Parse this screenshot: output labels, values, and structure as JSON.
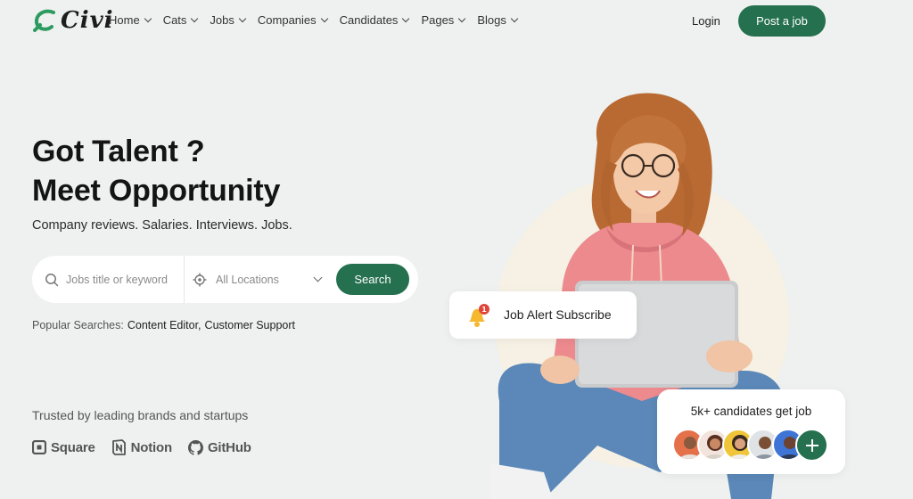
{
  "brand": {
    "name": "Civi"
  },
  "nav": {
    "items": [
      {
        "label": "Home"
      },
      {
        "label": "Cats"
      },
      {
        "label": "Jobs"
      },
      {
        "label": "Companies"
      },
      {
        "label": "Candidates"
      },
      {
        "label": "Pages"
      },
      {
        "label": "Blogs"
      }
    ],
    "login": "Login",
    "post_job": "Post a job"
  },
  "hero": {
    "title_line1": "Got Talent ?",
    "title_line2": "Meet Opportunity",
    "subtitle": "Company reviews. Salaries. Interviews. Jobs."
  },
  "search": {
    "keyword_placeholder": "Jobs title or keyword",
    "location_value": "All Locations",
    "button": "Search"
  },
  "popular": {
    "label": "Popular Searches:",
    "tags": [
      "Content Editor,",
      "Customer Support"
    ]
  },
  "trusted": {
    "label": "Trusted by leading brands and startups",
    "brands": [
      "Square",
      "Notion",
      "GitHub"
    ]
  },
  "alert_card": {
    "text": "Job Alert Subscribe",
    "badge": "1"
  },
  "candidates_card": {
    "text": "5k+ candidates get job"
  },
  "colors": {
    "accent": "#25704f",
    "background": "#eef1ef",
    "bell": "#f5b82e",
    "badge": "#e0443a"
  }
}
